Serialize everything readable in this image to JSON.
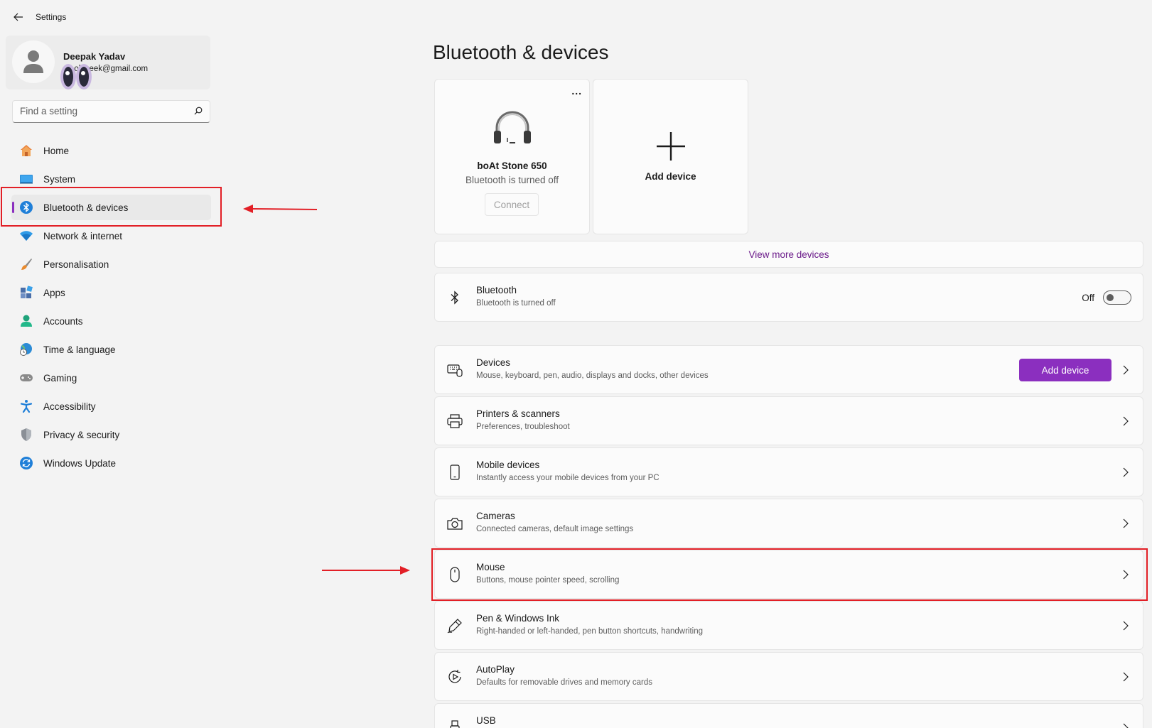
{
  "window": {
    "title": "Settings"
  },
  "profile": {
    "name": "Deepak Yadav",
    "email": "mysolsgeek@gmail.com",
    "email_visible": "olsgeek@gmail.com"
  },
  "search": {
    "placeholder": "Find a setting"
  },
  "nav": {
    "items": [
      {
        "label": "Home",
        "icon": "home-icon"
      },
      {
        "label": "System",
        "icon": "system-icon"
      },
      {
        "label": "Bluetooth & devices",
        "icon": "bluetooth-icon",
        "active": true
      },
      {
        "label": "Network & internet",
        "icon": "wifi-icon"
      },
      {
        "label": "Personalisation",
        "icon": "brush-icon"
      },
      {
        "label": "Apps",
        "icon": "apps-icon"
      },
      {
        "label": "Accounts",
        "icon": "accounts-icon"
      },
      {
        "label": "Time & language",
        "icon": "globe-clock-icon"
      },
      {
        "label": "Gaming",
        "icon": "gamepad-icon"
      },
      {
        "label": "Accessibility",
        "icon": "accessibility-icon"
      },
      {
        "label": "Privacy & security",
        "icon": "shield-icon"
      },
      {
        "label": "Windows Update",
        "icon": "update-icon"
      }
    ]
  },
  "main": {
    "title": "Bluetooth & devices",
    "device": {
      "name": "boAt Stone 650",
      "status": "Bluetooth is turned off",
      "connect": "Connect",
      "more": "..."
    },
    "add_card": {
      "label": "Add device"
    },
    "view_more": "View more devices",
    "bluetooth": {
      "title": "Bluetooth",
      "sub": "Bluetooth is turned off",
      "state": "Off"
    },
    "rows": [
      {
        "title": "Devices",
        "sub": "Mouse, keyboard, pen, audio, displays and docks, other devices",
        "button": "Add device"
      },
      {
        "title": "Printers & scanners",
        "sub": "Preferences, troubleshoot"
      },
      {
        "title": "Mobile devices",
        "sub": "Instantly access your mobile devices from your PC"
      },
      {
        "title": "Cameras",
        "sub": "Connected cameras, default image settings"
      },
      {
        "title": "Mouse",
        "sub": "Buttons, mouse pointer speed, scrolling"
      },
      {
        "title": "Pen & Windows Ink",
        "sub": "Right-handed or left-handed, pen button shortcuts, handwriting"
      },
      {
        "title": "AutoPlay",
        "sub": "Defaults for removable drives and memory cards"
      },
      {
        "title": "USB",
        "sub": ""
      }
    ]
  },
  "colors": {
    "accent": "#8b2fbf",
    "annotation": "#e21f26",
    "link": "#6b1b8a"
  }
}
